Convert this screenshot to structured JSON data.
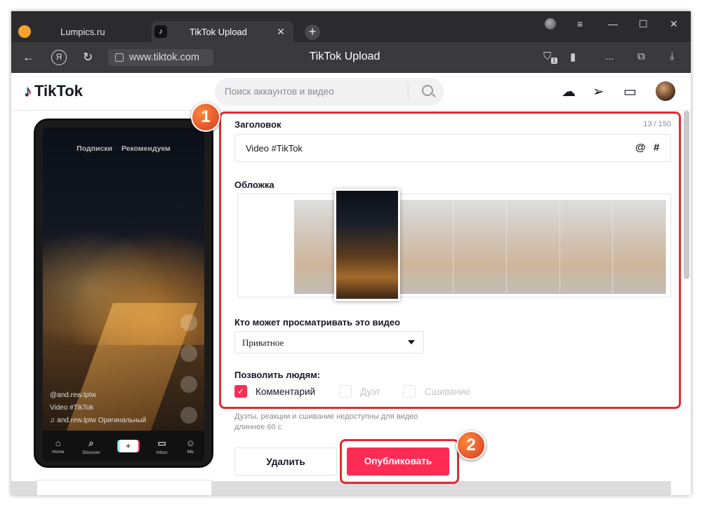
{
  "browser": {
    "tabs": [
      {
        "label": "Lumpics.ru",
        "active": false
      },
      {
        "label": "TikTok Upload",
        "active": true
      }
    ],
    "new_tab": "+",
    "url": "www.tiktok.com",
    "page_title": "TikTok Upload",
    "window_controls": {
      "menu": "≡",
      "minimize": "—",
      "maximize": "☐",
      "close": "✕"
    },
    "tab_close": "✕",
    "ya_letter": "Я",
    "shield_count": "1",
    "more": "...",
    "download": "⤓"
  },
  "tiktok_header": {
    "logo_text": "TikTok",
    "search_placeholder": "Поиск аккаунтов и видео"
  },
  "phone_preview": {
    "top_tabs": [
      "Подписки",
      "Рекомендуем"
    ],
    "username": "@and.rew.lptw",
    "caption": "Video #TikTok",
    "sound": "♫  and.rew.lptw Оригинальный",
    "nav": [
      {
        "icon": "⌂",
        "label": "Home"
      },
      {
        "icon": "⌕",
        "label": "Discover"
      },
      {
        "icon": "+",
        "label": ""
      },
      {
        "icon": "▭",
        "label": "Inbox"
      },
      {
        "icon": "☺",
        "label": "Me"
      }
    ]
  },
  "form": {
    "caption_label": "Заголовок",
    "caption_counter": "13 / 150",
    "caption_value": "Video #TikTok",
    "mention_symbol": "@",
    "hashtag_symbol": "#",
    "cover_label": "Обложка",
    "privacy_label": "Кто может просматривать это видео",
    "privacy_value": "Приватное",
    "allow_label": "Позволить людям:",
    "options": [
      {
        "label": "Комментарий",
        "checked": true
      },
      {
        "label": "Дуэт",
        "checked": false
      },
      {
        "label": "Сшивание",
        "checked": false
      }
    ],
    "note_line1": "Дуэты, реакции и сшивание недоступны для видео",
    "note_line2": "длиннее 60 с",
    "delete_button": "Удалить",
    "publish_button": "Опубликовать"
  },
  "annotations": {
    "badge1": "1",
    "badge2": "2"
  },
  "colors": {
    "accent": "#fe2c55",
    "annotation_red": "#e32b30",
    "badge_orange": "#e4552b"
  }
}
